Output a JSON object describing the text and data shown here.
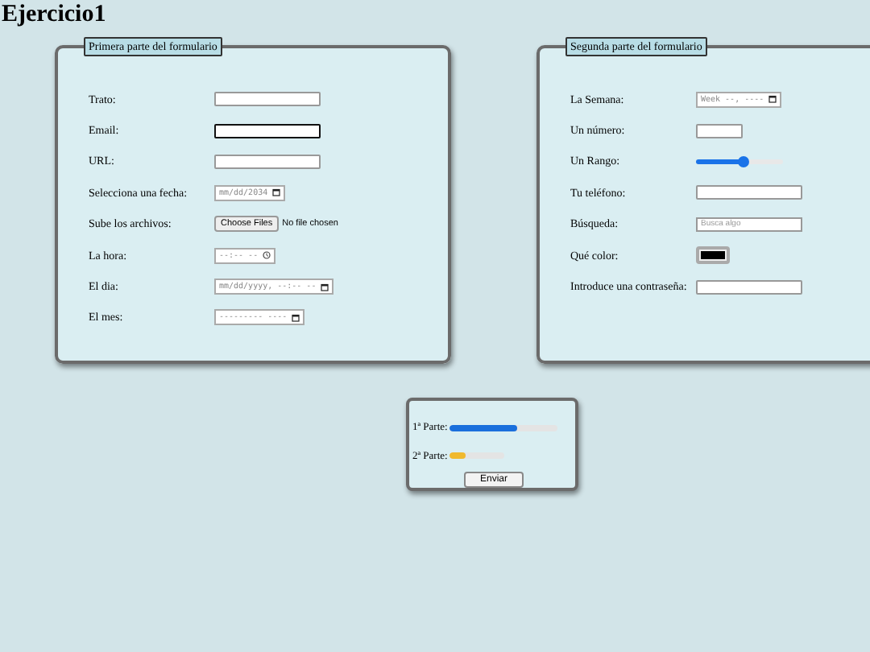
{
  "title": "Ejercicio1",
  "panels": [
    {
      "legend": "Primera parte del formulario",
      "fields": [
        {
          "label": "Trato:",
          "kind": "text",
          "focused": false
        },
        {
          "label": "Email:",
          "kind": "text",
          "focused": true
        },
        {
          "label": "URL:",
          "kind": "text",
          "focused": false
        },
        {
          "label": "Selecciona una fecha:",
          "kind": "date",
          "text": "mm/dd/2034"
        },
        {
          "label": "Sube los archivos:",
          "kind": "file",
          "button": "Choose Files",
          "text": "No file chosen"
        },
        {
          "label": "La hora:",
          "kind": "time",
          "text": "--:-- --"
        },
        {
          "label": "El dia:",
          "kind": "date",
          "text": "mm/dd/yyyy, --:-- --"
        },
        {
          "label": "El mes:",
          "kind": "date",
          "text": "--------- ----"
        }
      ]
    },
    {
      "legend": "Segunda parte del formulario",
      "fields": [
        {
          "label": "La Semana:",
          "kind": "date",
          "text": "Week --, ----"
        },
        {
          "label": "Un número:",
          "kind": "number",
          "focused": false
        },
        {
          "label": "Un Rango:",
          "kind": "range",
          "level": 0.55
        },
        {
          "label": "Tu teléfono:",
          "kind": "text",
          "focused": false
        },
        {
          "label": "Búsqueda:",
          "kind": "search",
          "placeholder": "Busca algo"
        },
        {
          "label": "Qué color:",
          "kind": "color",
          "color": "#000000"
        },
        {
          "label": "Introduce una contraseña:",
          "kind": "text",
          "focused": false
        }
      ]
    }
  ],
  "progress": [
    {
      "label": "1ª Parte:",
      "level": 0.63,
      "color": "#1a6fdc"
    },
    {
      "label": "2ª Parte:",
      "level": 0.3,
      "color": "#f0b92e"
    }
  ],
  "submit": "Enviar"
}
